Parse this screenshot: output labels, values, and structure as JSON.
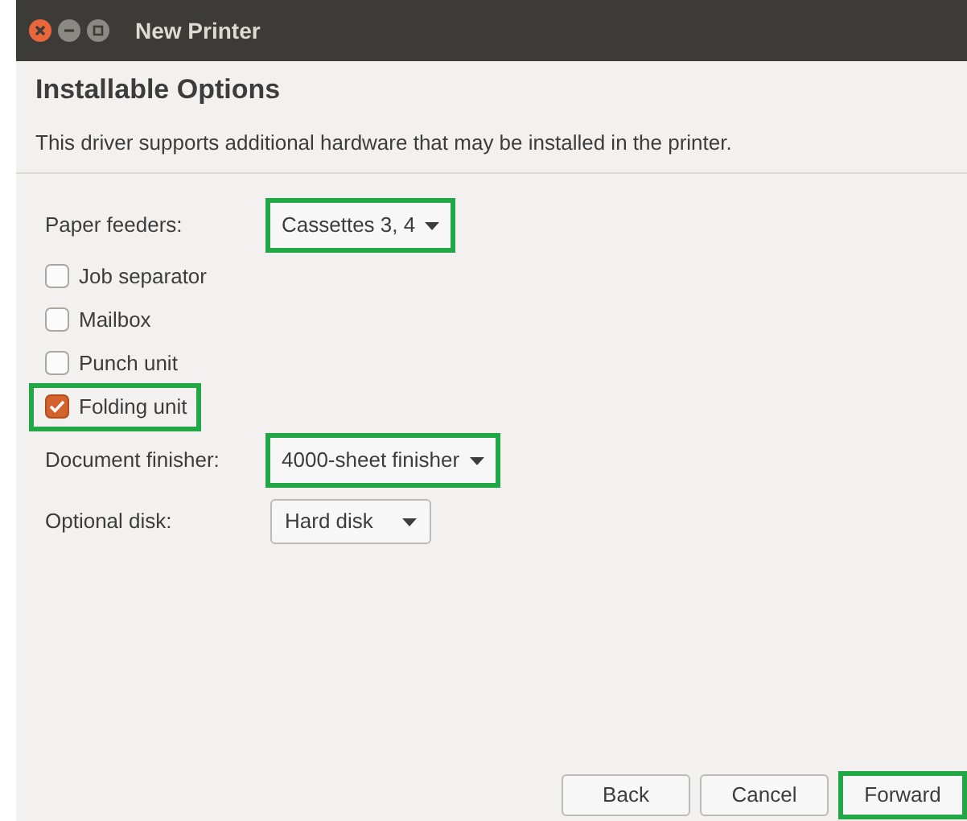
{
  "window": {
    "title": "New Printer"
  },
  "heading": "Installable Options",
  "description": "This driver supports additional hardware that may be installed in the printer.",
  "options": [
    {
      "kind": "dropdown",
      "label": "Paper feeders:",
      "value": "Cassettes 3, 4",
      "highlighted": true
    },
    {
      "kind": "checkbox",
      "label": "Job separator",
      "checked": false,
      "highlighted": false
    },
    {
      "kind": "checkbox",
      "label": "Mailbox",
      "checked": false,
      "highlighted": false
    },
    {
      "kind": "checkbox",
      "label": "Punch unit",
      "checked": false,
      "highlighted": false
    },
    {
      "kind": "checkbox",
      "label": "Folding unit",
      "checked": true,
      "highlighted": true
    },
    {
      "kind": "dropdown",
      "label": "Document finisher:",
      "value": "4000-sheet finisher",
      "highlighted": true
    },
    {
      "kind": "dropdown",
      "label": "Optional disk:",
      "value": "Hard disk",
      "highlighted": false
    }
  ],
  "buttons": [
    {
      "label": "Back",
      "highlighted": false
    },
    {
      "label": "Cancel",
      "highlighted": false
    },
    {
      "label": "Forward",
      "highlighted": true
    }
  ]
}
